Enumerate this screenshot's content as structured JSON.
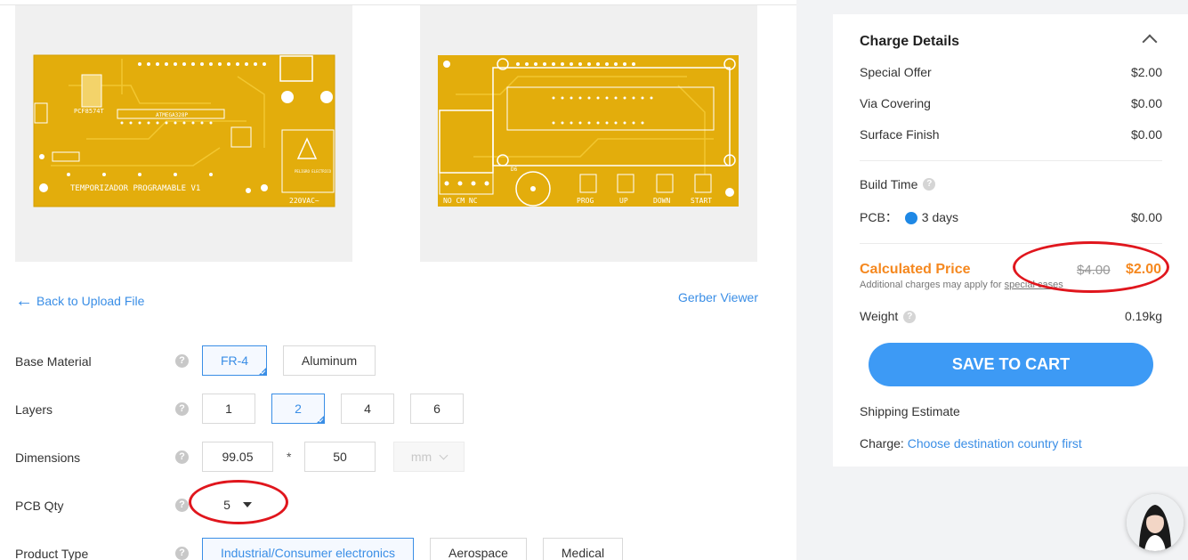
{
  "preview": {
    "left_board": {
      "chip_label": "PCF8574T",
      "mcu_label": "ATMEGA328P",
      "text": "TEMPORIZADOR PROGRAMABLE V1",
      "voltage": "220VAC~",
      "warning": "PELIGRO ELECTRICO"
    },
    "right_board": {
      "relay_label": "NO CM NC",
      "d_label": "D6",
      "buttons": [
        "PROG",
        "UP",
        "DOWN",
        "START"
      ]
    }
  },
  "links": {
    "back": "Back to Upload File",
    "gerber": "Gerber Viewer"
  },
  "form": {
    "base_material": {
      "label": "Base Material",
      "options": [
        "FR-4",
        "Aluminum"
      ],
      "selected": "FR-4"
    },
    "layers": {
      "label": "Layers",
      "options": [
        "1",
        "2",
        "4",
        "6"
      ],
      "selected": "2"
    },
    "dimensions": {
      "label": "Dimensions",
      "width": "99.05",
      "separator": "*",
      "height": "50",
      "unit": "mm"
    },
    "pcb_qty": {
      "label": "PCB Qty",
      "value": "5"
    },
    "product_type": {
      "label": "Product Type",
      "options": [
        "Industrial/Consumer electronics",
        "Aerospace",
        "Medical"
      ],
      "selected": "Industrial/Consumer electronics"
    },
    "help_symbol": "?"
  },
  "charge_details": {
    "title": "Charge Details",
    "items": [
      {
        "label": "Special Offer",
        "value": "$2.00"
      },
      {
        "label": "Via Covering",
        "value": "$0.00"
      },
      {
        "label": "Surface Finish",
        "value": "$0.00"
      }
    ],
    "build_time_label": "Build Time",
    "pcb_label": "PCB：",
    "pcb_days": "3 days",
    "pcb_value": "$0.00",
    "calculated_label": "Calculated Price",
    "note_prefix": "Additional charges may apply for ",
    "note_link": "special cases",
    "old_price": "$4.00",
    "new_price": "$2.00",
    "weight_label": "Weight",
    "weight_value": "0.19kg",
    "save_button": "SAVE TO CART",
    "shipping_label": "Shipping Estimate",
    "charge_label": "Charge:",
    "charge_link": "Choose destination country first"
  },
  "colors": {
    "accent": "#3a8ee6",
    "orange": "#f5881f",
    "annotation_red": "#e0161d",
    "pcb_yellow": "#e6b000"
  }
}
